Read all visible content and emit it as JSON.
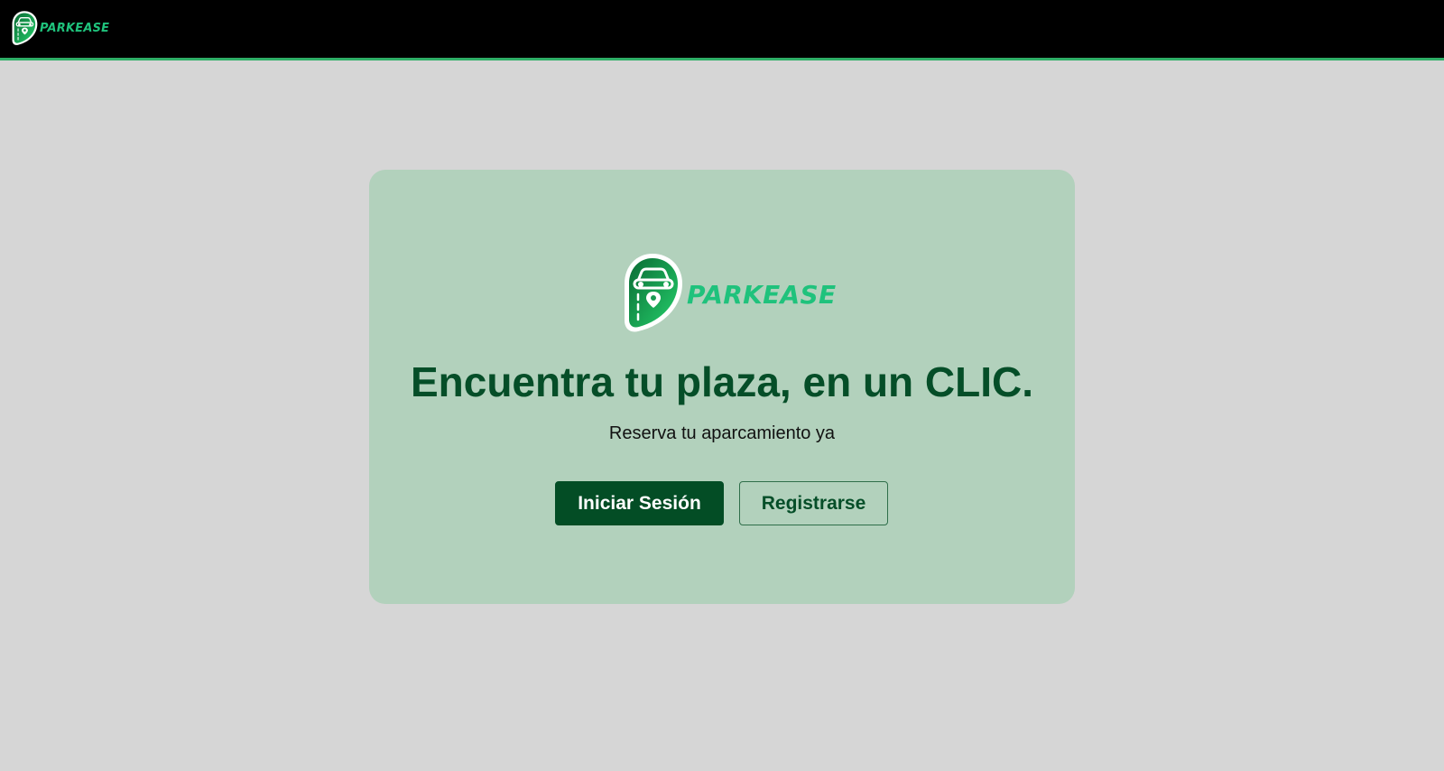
{
  "brand": {
    "name": "PARKEASE",
    "logo_icon": "parking-pin-car-icon"
  },
  "hero": {
    "headline": "Encuentra tu plaza, en un CLIC.",
    "subtitle": "Reserva tu aparcamiento ya"
  },
  "actions": {
    "login_label": "Iniciar Sesión",
    "register_label": "Registrarse"
  },
  "colors": {
    "topbar_bg": "#000000",
    "accent_line": "#2fae67",
    "page_bg": "#d6d6d6",
    "card_bg": "#b2d1bc",
    "brand_green": "#1fc27c",
    "dark_green": "#034d25"
  }
}
